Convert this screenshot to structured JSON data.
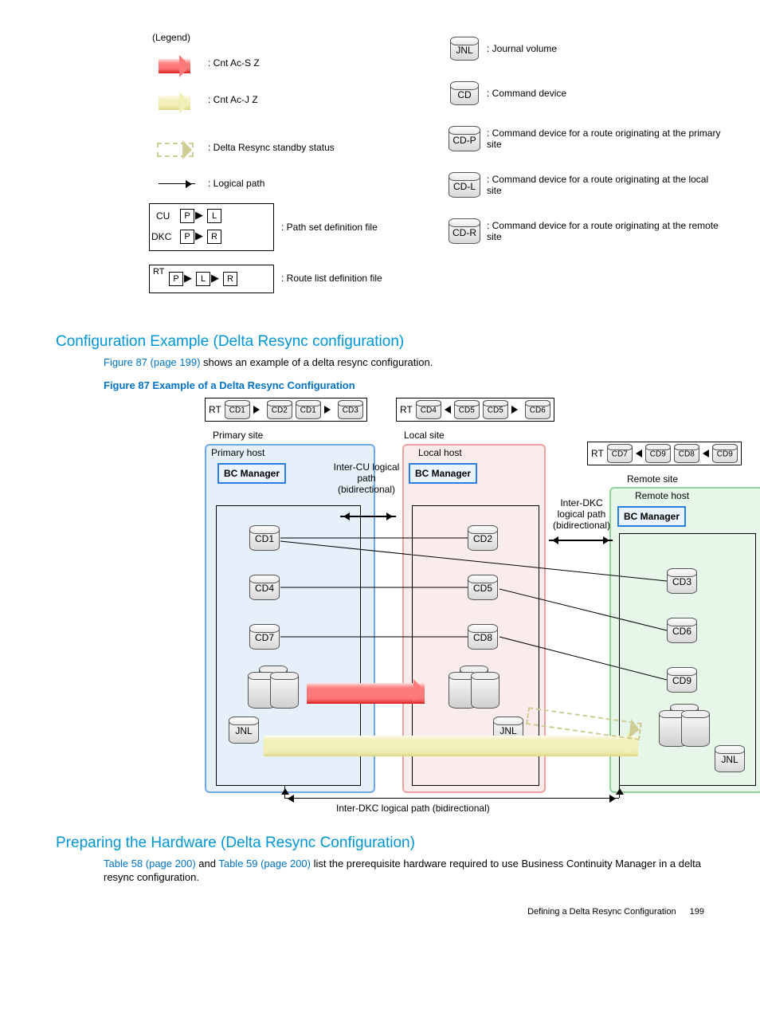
{
  "legend": {
    "title": "(Legend)",
    "items_left": [
      ": Cnt Ac-S Z",
      ": Cnt Ac-J Z",
      ": Delta Resync standby status",
      ": Logical path",
      ": Path set definition file",
      ": Route list definition file"
    ],
    "path_set": {
      "cu": "CU",
      "dkc": "DKC",
      "p": "P",
      "l": "L",
      "r": "R"
    },
    "route_list": {
      "rt": "RT",
      "p": "P",
      "l": "L",
      "r": "R"
    },
    "items_right": [
      {
        "abbr": "JNL",
        "desc": ": Journal volume"
      },
      {
        "abbr": "CD",
        "desc": ": Command device"
      },
      {
        "abbr": "CD-P",
        "desc": ": Command device for a route originating at the primary site"
      },
      {
        "abbr": "CD-L",
        "desc": ": Command device for a route originating at the local site"
      },
      {
        "abbr": "CD-R",
        "desc": ": Command device for a route originating at the remote site"
      }
    ]
  },
  "section1": {
    "heading": "Configuration Example (Delta Resync configuration)",
    "para_before": "",
    "link": "Figure 87 (page 199)",
    "para_after": " shows an example of a delta resync configuration.",
    "figcap": "Figure 87 Example of a Delta Resync Configuration"
  },
  "fig87": {
    "rt_label": "RT",
    "rt1": [
      "CD1",
      "CD2",
      "CD1",
      "CD3"
    ],
    "rt2": [
      "CD4",
      "CD5",
      "CD5",
      "CD6"
    ],
    "rt3": [
      "CD7",
      "CD9",
      "CD8",
      "CD9"
    ],
    "primary_site": "Primary site",
    "primary_host": "Primary host",
    "local_site": "Local site",
    "local_host": "Local host",
    "remote_site": "Remote site",
    "remote_host": "Remote host",
    "bcm": "BC Manager",
    "inter_cu": "Inter-CU logical path (bidirectional)",
    "inter_dkc": "Inter-DKC logical path (bidirectional)",
    "inter_dkc_bottom": "Inter-DKC logical path (bidirectional)",
    "primary_cds": [
      "CD1",
      "CD4",
      "CD7"
    ],
    "local_cds": [
      "CD2",
      "CD5",
      "CD8"
    ],
    "remote_cds": [
      "CD3",
      "CD6",
      "CD9"
    ],
    "jnl": "JNL"
  },
  "section2": {
    "heading": "Preparing the Hardware (Delta Resync Configuration)",
    "link1": "Table 58 (page 200)",
    "mid": " and ",
    "link2": "Table 59 (page 200)",
    "after": " list the prerequisite hardware required to use Business Continuity Manager in a delta resync configuration."
  },
  "footer": {
    "title": "Defining a Delta Resync Configuration",
    "page": "199"
  }
}
